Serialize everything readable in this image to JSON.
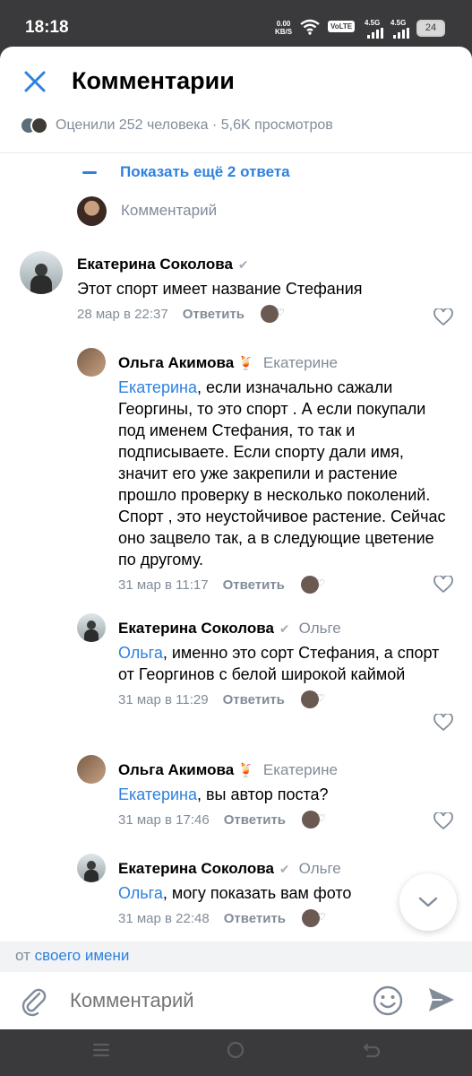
{
  "status_bar": {
    "time": "18:18",
    "net_speed_value": "0.00",
    "net_speed_unit": "KB/S",
    "volte": "VoLTE",
    "sim1_net": "4.5G",
    "sim2_net": "4.5G",
    "battery": "24"
  },
  "header": {
    "title": "Комментарии",
    "likes_text": "Оценили 252 человека · 5,6K просмотров"
  },
  "thread": {
    "show_more_label": "Показать ещё 2 ответа",
    "reply_placeholder": "Комментарий"
  },
  "comments": [
    {
      "author": "Екатерина Соколова",
      "to": "",
      "mention": "",
      "text": "Этот спорт имеет название Стефания",
      "date": "28 мар в 22:37",
      "reply_label": "Ответить"
    },
    {
      "author": "Ольга Акимова",
      "emoji": "🍹",
      "to": "Екатерине",
      "mention": "Екатерина",
      "text": ", если изначально сажали Георгины, то это спорт . А если покупали под именем Стефания, то так и подписываете. Если спорту дали имя, значит его уже закрепили и растение прошло проверку в несколько поколений. Спорт , это неустойчивое растение. Сейчас оно зацвело так, а в следующие цветение по другому.",
      "date": "31 мар в 11:17",
      "reply_label": "Ответить"
    },
    {
      "author": "Екатерина Соколова",
      "to": "Ольге",
      "mention": "Ольга",
      "text": ", именно это сорт  Стефания, а спорт от Георгинов с белой широкой каймой",
      "date": "31 мар в 11:29",
      "reply_label": "Ответить"
    },
    {
      "author": "Ольга Акимова",
      "emoji": "🍹",
      "to": "Екатерине",
      "mention": "Екатерина",
      "text": ", вы автор поста?",
      "date": "31 мар в 17:46",
      "reply_label": "Ответить"
    },
    {
      "author": "Екатерина Соколова",
      "to": "Ольге",
      "mention": "Ольга",
      "text": ", могу показать вам фото",
      "date": "31 мар в 22:48",
      "reply_label": "Ответить"
    }
  ],
  "from_bar": {
    "prefix": "от",
    "link": "своего имени"
  },
  "composer": {
    "placeholder": "Комментарий"
  },
  "colors": {
    "accent": "#2d81e0",
    "secondary_text": "#818c99",
    "verified": "#a3adb8"
  },
  "icons": [
    "close-icon",
    "attach-icon",
    "emoji-icon",
    "send-icon",
    "heart-icon",
    "chevron-down-icon",
    "verified-icon"
  ]
}
